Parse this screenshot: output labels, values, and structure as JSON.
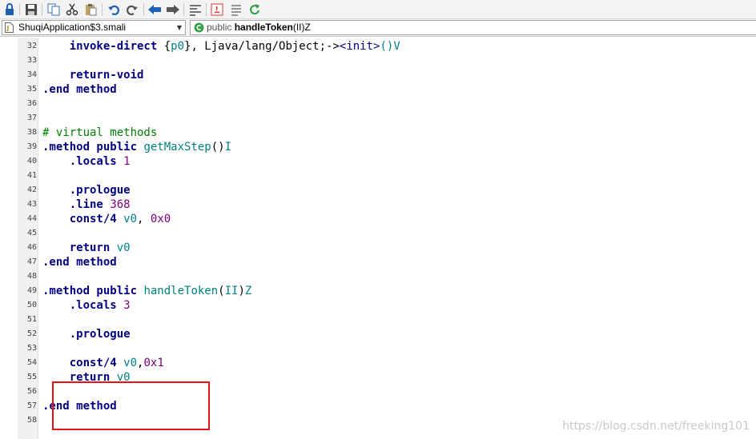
{
  "toolbar": {
    "icons": [
      "lock-icon",
      "save-icon",
      "copy-icon",
      "cut-icon",
      "paste-icon",
      "undo-icon",
      "redo-icon",
      "back-icon",
      "forward-icon",
      "format-icon",
      "java-icon",
      "list-icon",
      "refresh-icon"
    ]
  },
  "navbar": {
    "file_combo": "ShuqiApplication$3.smali",
    "method_combo": {
      "modifier": "public",
      "name": "handleToken",
      "signature": "(II)Z"
    }
  },
  "colors": {
    "directive": "#000080",
    "register": "#008080",
    "number": "#800080",
    "comment": "#008000",
    "highlight_box": "#e3141c"
  },
  "code_lines": [
    {
      "num": "32",
      "tokens": [
        {
          "t": "    "
        },
        {
          "t": "invoke-direct",
          "c": "kw"
        },
        {
          "t": " {"
        },
        {
          "t": "p0",
          "c": "reg"
        },
        {
          "t": "}, Ljava/lang/Object;->"
        },
        {
          "t": "<init>",
          "c": "name"
        },
        {
          "t": "()V",
          "c": "fn"
        }
      ]
    },
    {
      "num": "33",
      "tokens": []
    },
    {
      "num": "34",
      "tokens": [
        {
          "t": "    "
        },
        {
          "t": "return-void",
          "c": "kw"
        }
      ]
    },
    {
      "num": "35",
      "tokens": [
        {
          "t": ".end method",
          "c": "kw"
        }
      ]
    },
    {
      "num": "36",
      "tokens": []
    },
    {
      "num": "37",
      "tokens": []
    },
    {
      "num": "38",
      "tokens": [
        {
          "t": "# virtual methods",
          "c": "cm"
        }
      ]
    },
    {
      "num": "39",
      "tokens": [
        {
          "t": ".method public",
          "c": "kw"
        },
        {
          "t": " "
        },
        {
          "t": "getMaxStep",
          "c": "fn"
        },
        {
          "t": "()"
        },
        {
          "t": "I",
          "c": "fn"
        }
      ]
    },
    {
      "num": "40",
      "tokens": [
        {
          "t": "    "
        },
        {
          "t": ".locals",
          "c": "kw"
        },
        {
          "t": " "
        },
        {
          "t": "1",
          "c": "num"
        }
      ]
    },
    {
      "num": "41",
      "tokens": []
    },
    {
      "num": "42",
      "tokens": [
        {
          "t": "    "
        },
        {
          "t": ".prologue",
          "c": "kw"
        }
      ]
    },
    {
      "num": "43",
      "tokens": [
        {
          "t": "    "
        },
        {
          "t": ".line",
          "c": "kw"
        },
        {
          "t": " "
        },
        {
          "t": "368",
          "c": "num"
        }
      ]
    },
    {
      "num": "44",
      "tokens": [
        {
          "t": "    "
        },
        {
          "t": "const/4",
          "c": "kw"
        },
        {
          "t": " "
        },
        {
          "t": "v0",
          "c": "reg"
        },
        {
          "t": ", "
        },
        {
          "t": "0x0",
          "c": "num"
        }
      ]
    },
    {
      "num": "45",
      "tokens": []
    },
    {
      "num": "46",
      "tokens": [
        {
          "t": "    "
        },
        {
          "t": "return",
          "c": "kw"
        },
        {
          "t": " "
        },
        {
          "t": "v0",
          "c": "reg"
        }
      ]
    },
    {
      "num": "47",
      "tokens": [
        {
          "t": ".end method",
          "c": "kw"
        }
      ]
    },
    {
      "num": "48",
      "tokens": []
    },
    {
      "num": "49",
      "tokens": [
        {
          "t": ".method public",
          "c": "kw"
        },
        {
          "t": " "
        },
        {
          "t": "handleToken",
          "c": "fn"
        },
        {
          "t": "("
        },
        {
          "t": "II",
          "c": "fn"
        },
        {
          "t": ")"
        },
        {
          "t": "Z",
          "c": "fn"
        }
      ]
    },
    {
      "num": "50",
      "tokens": [
        {
          "t": "    "
        },
        {
          "t": ".locals",
          "c": "kw"
        },
        {
          "t": " "
        },
        {
          "t": "3",
          "c": "num"
        }
      ]
    },
    {
      "num": "51",
      "tokens": []
    },
    {
      "num": "52",
      "tokens": [
        {
          "t": "    "
        },
        {
          "t": ".prologue",
          "c": "kw"
        }
      ]
    },
    {
      "num": "53",
      "tokens": []
    },
    {
      "num": "54",
      "tokens": [
        {
          "t": "    "
        },
        {
          "t": "const/4",
          "c": "kw"
        },
        {
          "t": " "
        },
        {
          "t": "v0",
          "c": "reg"
        },
        {
          "t": ","
        },
        {
          "t": "0x1",
          "c": "num"
        }
      ]
    },
    {
      "num": "55",
      "tokens": [
        {
          "t": "    "
        },
        {
          "t": "return",
          "c": "kw"
        },
        {
          "t": " "
        },
        {
          "t": "v0",
          "c": "reg"
        }
      ]
    },
    {
      "num": "56",
      "tokens": []
    },
    {
      "num": "57",
      "tokens": [
        {
          "t": ".end method",
          "c": "kw"
        }
      ]
    },
    {
      "num": "58",
      "tokens": []
    }
  ],
  "watermark": "https://blog.csdn.net/freeking101"
}
